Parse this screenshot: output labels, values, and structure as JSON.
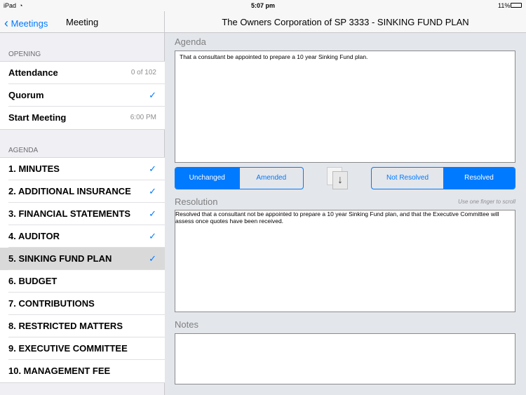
{
  "status": {
    "device": "iPad",
    "time": "5:07 pm",
    "battery": "11%"
  },
  "nav": {
    "back": "Meetings",
    "left_title": "Meeting",
    "title": "The Owners Corporation of SP 3333 - SINKING FUND PLAN"
  },
  "sidebar": {
    "opening_header": "OPENING",
    "opening": [
      {
        "label": "Attendance",
        "value": "0 of 102"
      },
      {
        "label": "Quorum",
        "check": true
      },
      {
        "label": "Start Meeting",
        "value": "6:00 PM"
      }
    ],
    "agenda_header": "AGENDA",
    "agenda": [
      {
        "label": "1. MINUTES",
        "check": true
      },
      {
        "label": "2. ADDITIONAL INSURANCE",
        "check": true
      },
      {
        "label": "3. FINANCIAL STATEMENTS",
        "check": true
      },
      {
        "label": "4. AUDITOR",
        "check": true
      },
      {
        "label": "5. SINKING FUND PLAN",
        "check": true,
        "selected": true
      },
      {
        "label": "6. BUDGET"
      },
      {
        "label": "7. CONTRIBUTIONS"
      },
      {
        "label": "8. RESTRICTED MATTERS"
      },
      {
        "label": "9. EXECUTIVE COMMITTEE"
      },
      {
        "label": "10. MANAGEMENT FEE"
      }
    ]
  },
  "main": {
    "agenda_label": "Agenda",
    "agenda_text": "That a consultant be appointed to prepare a 10 year Sinking Fund plan.",
    "seg1": [
      "Unchanged",
      "Amended"
    ],
    "seg1_selected": "Unchanged",
    "seg2": [
      "Not Resolved",
      "Resolved"
    ],
    "seg2_selected": "Resolved",
    "resolution_label": "Resolution",
    "scroll_hint": "Use one finger to scroll",
    "resolution_text": "Resolved that a consultant not be appointed to prepare a 10 year Sinking Fund plan, and that the Executive Committee will assess once quotes have been received.",
    "notes_label": "Notes",
    "notes_text": ""
  }
}
